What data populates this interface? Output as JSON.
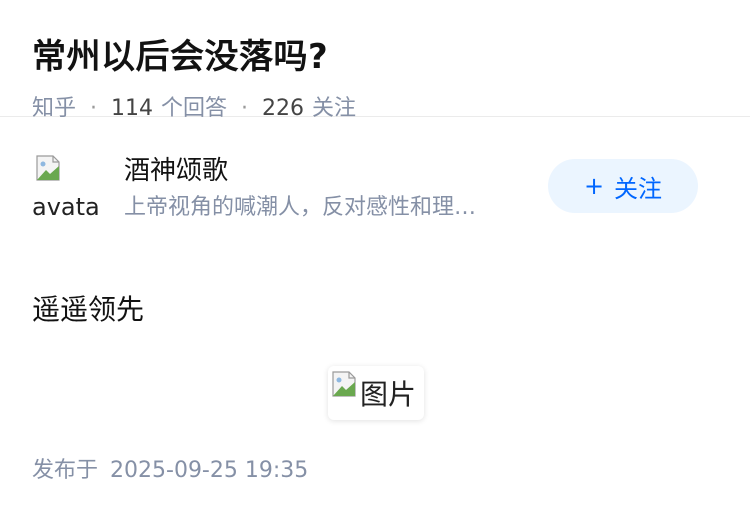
{
  "question": {
    "title": "常州以后会没落吗?",
    "source": "知乎",
    "answers_count": "114",
    "answers_label": "个回答",
    "followers_count": "226",
    "followers_label": "关注",
    "separator": "·"
  },
  "answer": {
    "author_name": "酒神颂歌",
    "author_bio": "上帝视角的喊潮人，反对感性和理…",
    "avatar_alt": "avatar",
    "follow_plus": "+",
    "follow_label": "关注",
    "content": "遥遥领先",
    "image_alt": "图片",
    "publish_label": "发布于",
    "publish_time": "2025-09-25 19:35"
  },
  "colors": {
    "accent": "#0066ff",
    "follow_bg": "#ebf5ff",
    "meta_text": "#8590a6"
  },
  "icons": {
    "broken_image": "broken-image-icon"
  }
}
